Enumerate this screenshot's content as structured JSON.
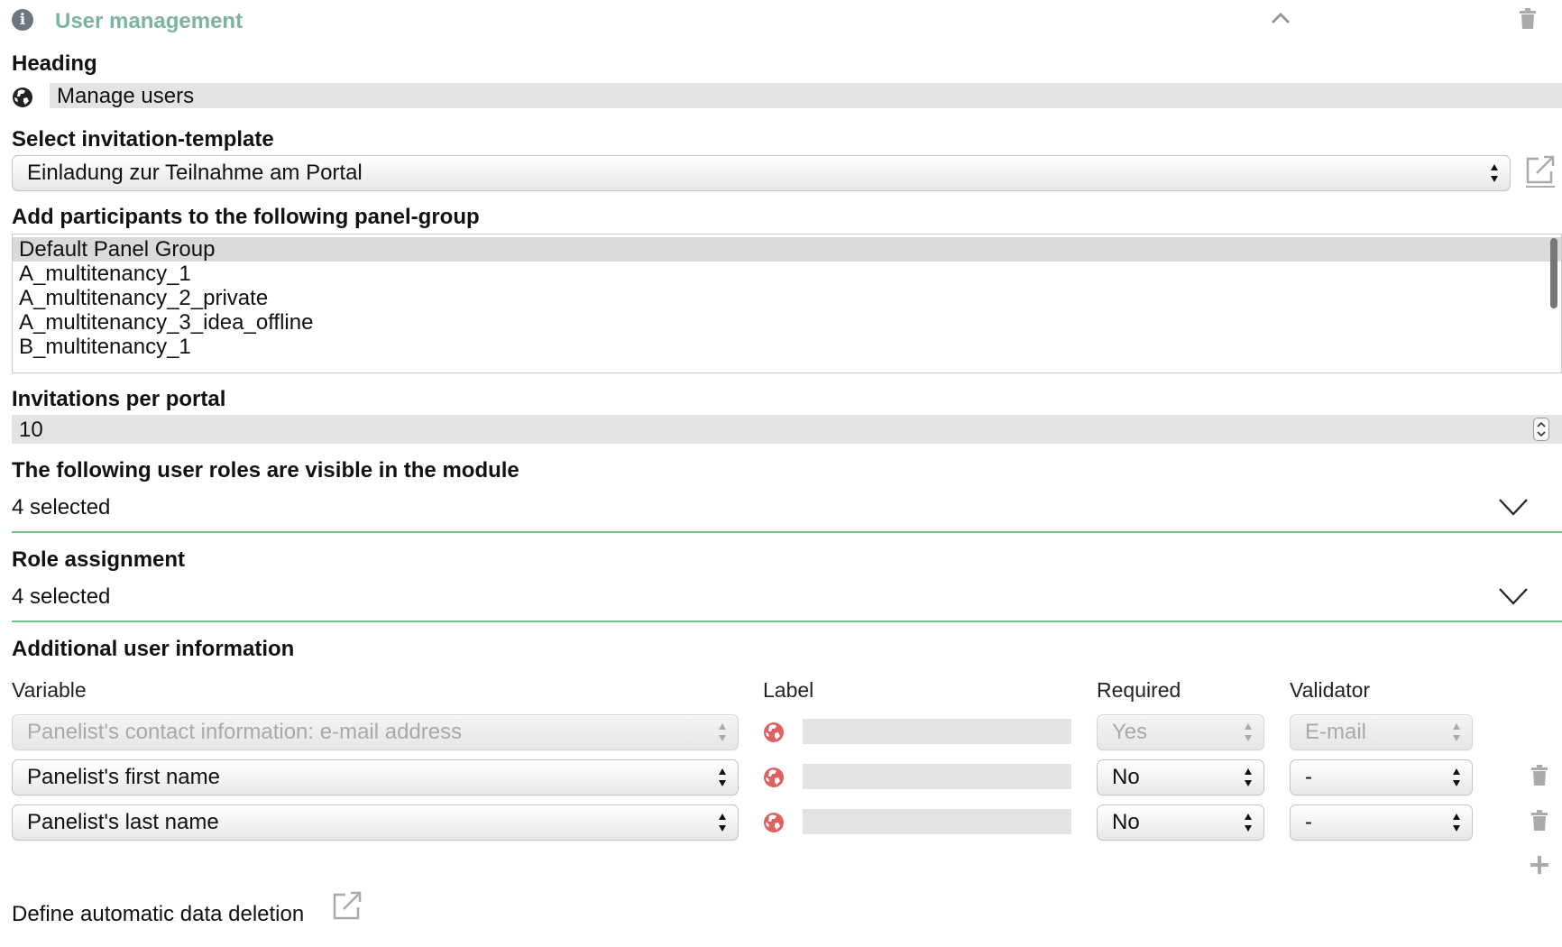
{
  "header": {
    "title": "User management"
  },
  "heading": {
    "label": "Heading",
    "value": "Manage users"
  },
  "invitation": {
    "label": "Select invitation-template",
    "selected": "Einladung zur Teilnahme am Portal"
  },
  "panel_group": {
    "label": "Add participants to the following panel-group",
    "options": [
      "Default Panel Group",
      "A_multitenancy_1",
      "A_multitenancy_2_private",
      "A_multitenancy_3_idea_offline",
      "B_multitenancy_1"
    ],
    "selected_index": 0
  },
  "invitations": {
    "label": "Invitations per portal",
    "value": "10"
  },
  "visible_roles": {
    "label": "The following user roles are visible in the module",
    "value": "4 selected"
  },
  "role_assignment": {
    "label": "Role assignment",
    "value": "4 selected"
  },
  "additional": {
    "label": "Additional user information",
    "columns": {
      "variable": "Variable",
      "label": "Label",
      "required": "Required",
      "validator": "Validator"
    },
    "rows": [
      {
        "variable": "Panelist's contact information: e-mail address",
        "label": "",
        "required": "Yes",
        "validator": "E-mail",
        "disabled": true
      },
      {
        "variable": "Panelist's first name",
        "label": "",
        "required": "No",
        "validator": "-",
        "disabled": false
      },
      {
        "variable": "Panelist's last name",
        "label": "",
        "required": "No",
        "validator": "-",
        "disabled": false
      }
    ]
  },
  "deletion": {
    "label": "Define automatic data deletion"
  },
  "colors": {
    "accent_green": "#7cb49a",
    "divider_green": "#6fc186",
    "globe_red": "#e06060"
  }
}
